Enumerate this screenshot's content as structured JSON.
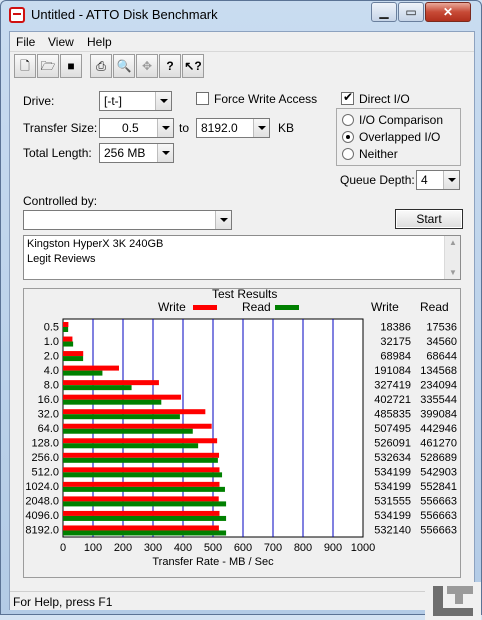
{
  "window": {
    "title": "Untitled - ATTO Disk Benchmark"
  },
  "menu": [
    "File",
    "View",
    "Help"
  ],
  "toolbar": {
    "buttons": [
      "new-file-icon",
      "open-folder-icon",
      "save-icon",
      "print-icon",
      "print-preview-icon",
      "move-icon",
      "help-icon",
      "context-help-icon"
    ]
  },
  "drive": {
    "label": "Drive:",
    "value": "[-t-]"
  },
  "force_write": {
    "label": "Force Write Access",
    "checked": false
  },
  "direct_io": {
    "label": "Direct I/O",
    "checked": true
  },
  "transfer_size": {
    "label": "Transfer Size:",
    "from": "0.5",
    "to_label": "to",
    "to": "8192.0",
    "unit": "KB"
  },
  "total_length": {
    "label": "Total Length:",
    "value": "256 MB"
  },
  "io_mode": {
    "options": [
      "I/O Comparison",
      "Overlapped I/O",
      "Neither"
    ],
    "selected": "Overlapped I/O"
  },
  "queue_depth": {
    "label": "Queue Depth:",
    "value": "4"
  },
  "controlled_by": {
    "label": "Controlled by:",
    "value": ""
  },
  "start_button": "Start",
  "description": [
    "Kingston HyperX 3K 240GB",
    "Legit Reviews"
  ],
  "results": {
    "title": "Test Results",
    "write_legend": "Write",
    "read_legend": "Read",
    "write_col": "Write",
    "read_col": "Read",
    "write_color": "#ff0000",
    "read_color": "#008000"
  },
  "chart_data": {
    "type": "bar",
    "orientation": "horizontal",
    "categories": [
      "0.5",
      "1.0",
      "2.0",
      "4.0",
      "8.0",
      "16.0",
      "32.0",
      "64.0",
      "128.0",
      "256.0",
      "512.0",
      "1024.0",
      "2048.0",
      "4096.0",
      "8192.0"
    ],
    "series": [
      {
        "name": "Write",
        "color": "#ff0000",
        "values": [
          18386,
          32175,
          68984,
          191084,
          327419,
          402721,
          485835,
          507495,
          526091,
          532634,
          534199,
          534199,
          531555,
          534199,
          532140
        ]
      },
      {
        "name": "Read",
        "color": "#008000",
        "values": [
          17536,
          34560,
          68644,
          134568,
          234094,
          335544,
          399084,
          442946,
          461270,
          528689,
          542903,
          552841,
          556663,
          556663,
          556663
        ]
      }
    ],
    "write_labels": [
      "18386",
      "32175",
      "68984",
      "191084",
      "327419",
      "402721",
      "485835",
      "507495",
      "526091",
      "532634",
      "534199",
      "534199",
      "531555",
      "534199",
      "532140"
    ],
    "read_labels": [
      "17536",
      "34560",
      "68644",
      "134568",
      "234094",
      "335544",
      "399084",
      "442946",
      "461270",
      "528689",
      "542903",
      "552841",
      "556663",
      "556663",
      "556663"
    ],
    "xlabel": "Transfer Rate - MB / Sec",
    "xlim": [
      0,
      1000
    ],
    "xticks": [
      "0",
      "100",
      "200",
      "300",
      "400",
      "500",
      "600",
      "700",
      "800",
      "900",
      "1000"
    ],
    "grid": true
  },
  "status": "For Help, press F1"
}
